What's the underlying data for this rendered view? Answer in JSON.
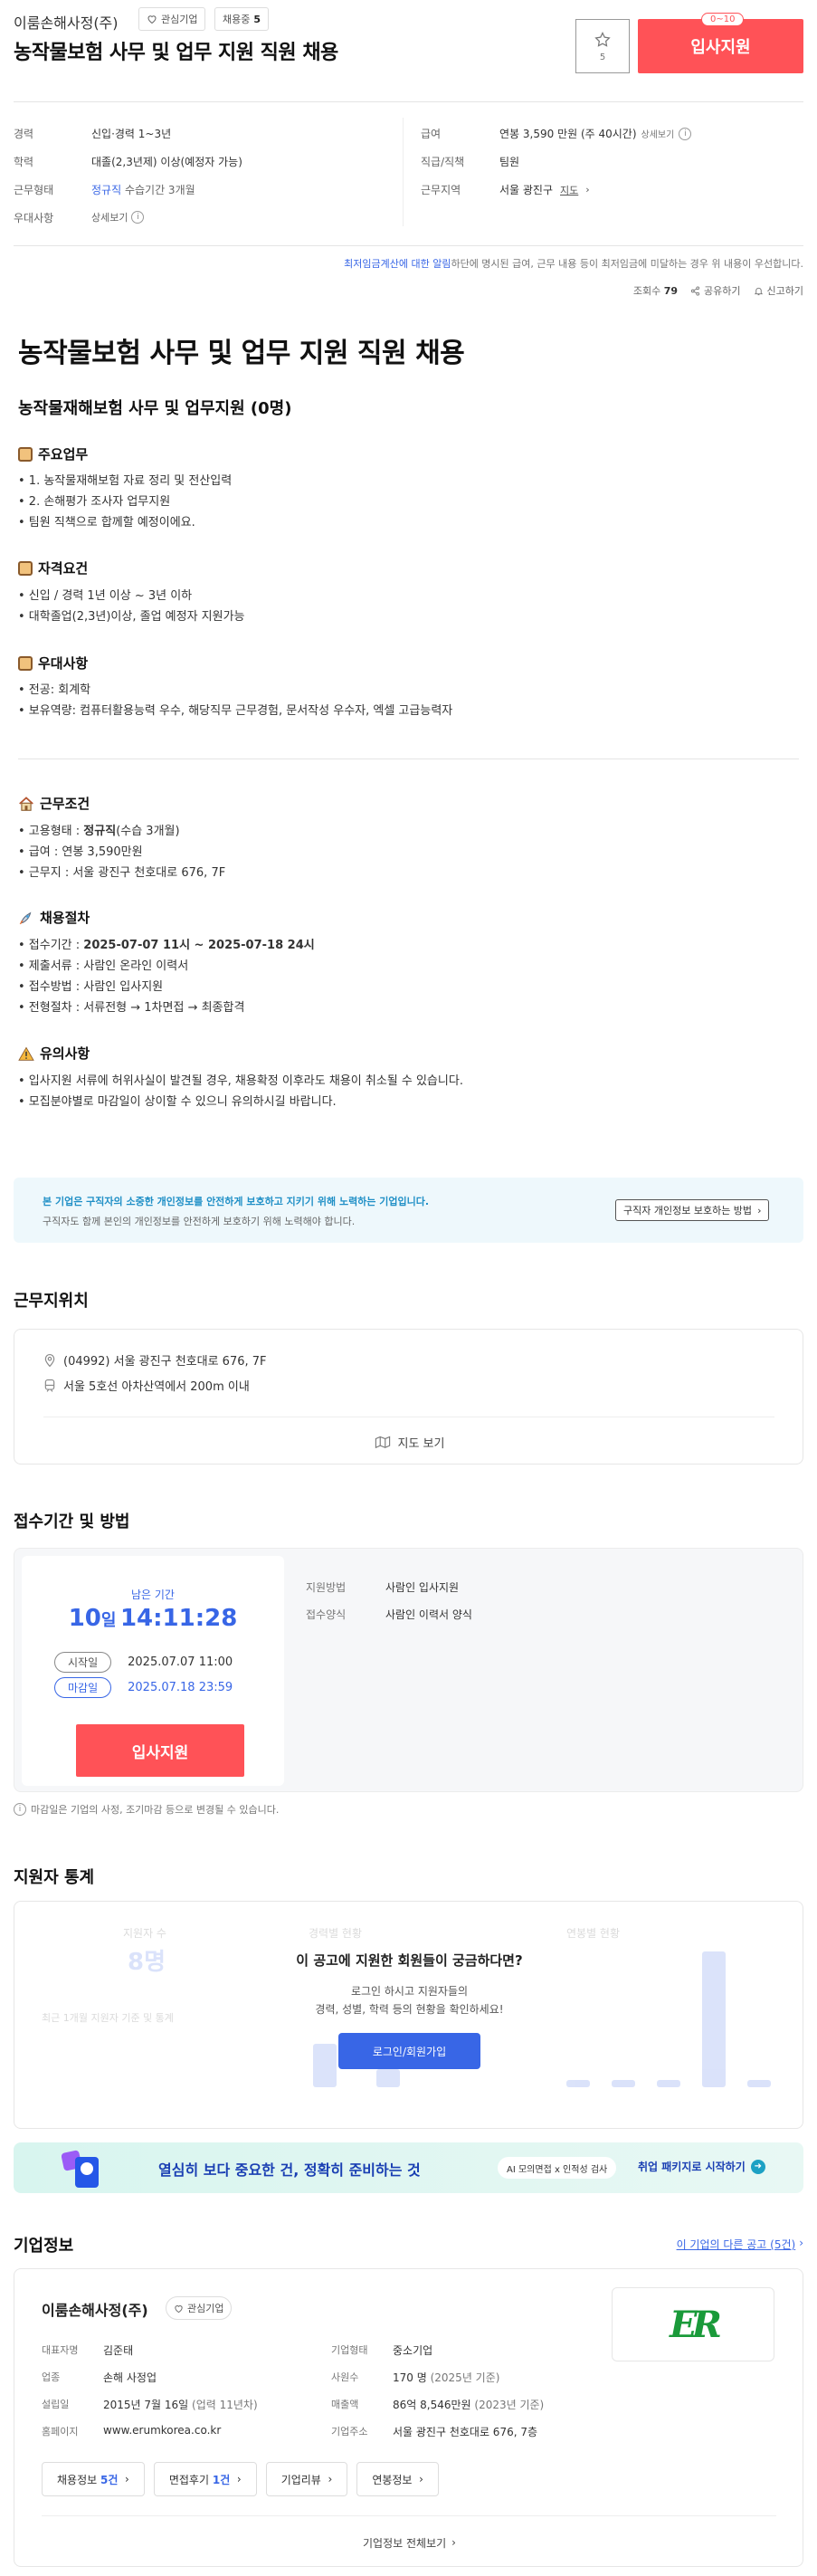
{
  "header": {
    "company": "이룸손해사정(주)",
    "interest_label": "관심기업",
    "hiring_label": "채용중",
    "hiring_count": "5",
    "title": "농작물보험 사무 및 업무 지원 직원 채용",
    "star_count": "5",
    "apply_badge": "0~10",
    "apply_label": "입사지원"
  },
  "summary": {
    "left": [
      {
        "label": "경력",
        "value": "신입·경력 1~3년"
      },
      {
        "label": "학력",
        "value": "대졸(2,3년제) 이상(예정자 가능)"
      },
      {
        "label": "근무형태",
        "value": "정규직",
        "value2": "수습기간 3개월"
      },
      {
        "label": "우대사항",
        "value": "상세보기"
      }
    ],
    "right": [
      {
        "label": "급여",
        "value": "연봉 3,590 만원 (주 40시간)",
        "extra": "상세보기"
      },
      {
        "label": "직급/직책",
        "value": "팀원"
      },
      {
        "label": "근무지역",
        "value": "서울 광진구",
        "extra": "지도"
      }
    ],
    "notice_link": "최저임금계산에 대한 알림",
    "notice_rest": "하단에 명시된 급여, 근무 내용 등이 최저임금에 미달하는 경우 위 내용이 우선합니다.",
    "views_label": "조회수",
    "views": "79",
    "share": "공유하기",
    "report": "신고하기"
  },
  "detail": {
    "title": "농작물보험 사무 및 업무 지원 직원 채용",
    "subtitle": "농작물재해보험 사무 및 업무지원 (0명)",
    "duties_title": "주요업무",
    "duties": [
      "• 1. 농작물재해보험 자료 정리 및 전산입력",
      "• 2. 손해평가 조사자 업무지원",
      "• 팀원 직책으로 합께할 예정이에요."
    ],
    "req_title": "자격요건",
    "reqs": [
      "• 신입 / 경력 1년 이상 ~ 3년 이하",
      "• 대학졸업(2,3년)이상, 졸업 예정자 지원가능"
    ],
    "pref_title": "우대사항",
    "prefs": [
      "• 전공: 회계학",
      "• 보유역량: 컴퓨터활용능력 우수, 해당직무 근무경험, 문서작성 우수자, 엑셀 고급능력자"
    ],
    "cond_title": "근무조건",
    "cond_emp_prefix": "• 고용형태 : ",
    "cond_emp_bold": "정규직",
    "cond_emp_suffix": "(수습 3개월)",
    "cond_salary": "• 급여 : 연봉 3,590만원",
    "cond_place": "• 근무지 : 서울 광진구 천호대로 676, 7F",
    "proc_title": "채용절차",
    "proc_period_prefix": "• 접수기간 : ",
    "proc_period_bold": "2025-07-07 11시 ~ 2025-07-18 24시",
    "proc_docs": "• 제출서류 : 사람인 온라인 이력서",
    "proc_method": "• 접수방법 : 사람인 입사지원",
    "proc_flow": "• 전형절차 : 서류전형 → 1차면접 → 최종합격",
    "note_title": "유의사항",
    "notes": [
      "• 입사지원 서류에 허위사실이 발견될 경우, 채용확정 이후라도 채용이 취소될 수 있습니다.",
      "• 모집분야별로 마감일이 상이할 수 있으니 유의하시길 바랍니다."
    ]
  },
  "privacy": {
    "title": "본 기업은 구직자의 소중한 개인정보를 안전하게 보호하고 지키기 위해 노력하는 기업입니다.",
    "desc": "구직자도 함께 본인의 개인정보를 안전하게 보호하기 위해 노력해야 합니다.",
    "button": "구직자 개인정보 보호하는 방법"
  },
  "location": {
    "title": "근무지위치",
    "address": "(04992) 서울 광진구 천호대로 676, 7F",
    "subway": "서울 5호선 아차산역에서 200m 이내",
    "map_button": "지도 보기"
  },
  "period": {
    "title": "접수기간 및 방법",
    "remain_label": "남은 기간",
    "remain_days": "10",
    "remain_day_unit": "일",
    "remain_time": "14:11:28",
    "start_label": "시작일",
    "start_date": "2025.07.07 11:00",
    "end_label": "마감일",
    "end_date": "2025.07.18 23:59",
    "apply": "입사지원",
    "method_label": "지원방법",
    "method_value": "사람인 입사지원",
    "form_label": "접수양식",
    "form_value": "사람인 이력서 양식",
    "footnote": "마감일은 기업의 사정, 조기마감 등으로 변경될 수 있습니다."
  },
  "stats": {
    "title": "지원자 통계",
    "bg_applicants": "지원자 수",
    "bg_count": "8명",
    "bg_career": "경력별 현황",
    "bg_salary": "연봉별 현황",
    "bg_note": "최근 1개월 지원자 기준 및 통계",
    "overlay_title": "이 공고에 지원한 회원들이 궁금하다면?",
    "overlay_desc1": "로그인 하시고 지원자들의",
    "overlay_desc2": "경력, 성별, 학력 등의 현황을 확인하세요!",
    "overlay_button": "로그인/회원가입",
    "bars": [
      0.05,
      0.05,
      0.05,
      0.88,
      0.05
    ],
    "career_bars": [
      0.28,
      0.12
    ]
  },
  "banner": {
    "text_a": "열심히 보다 중요한 건, ",
    "text_b": "정확히 준비하는 것",
    "chip": "AI 모의면접 x 인적성 검사",
    "cta": "취업 패키지로 시작하기"
  },
  "company": {
    "section_title": "기업정보",
    "other_jobs": "이 기업의 다른 공고 (5건)",
    "name": "이룸손해사정(주)",
    "interest": "관심기업",
    "rows_left": [
      {
        "label": "대표자명",
        "value": "김준태"
      },
      {
        "label": "업종",
        "value": "손해 사정업"
      },
      {
        "label": "설립일",
        "value": "2015년 7월 16일",
        "sub": "(업력 11년차)"
      },
      {
        "label": "홈페이지",
        "value": "www.erumkorea.co.kr"
      }
    ],
    "rows_right": [
      {
        "label": "기업형태",
        "value": "중소기업"
      },
      {
        "label": "사원수",
        "value": "170 명",
        "sub": "(2025년 기준)"
      },
      {
        "label": "매출액",
        "value": "86억 8,546만원",
        "sub": "(2023년 기준)"
      },
      {
        "label": "기업주소",
        "value": "서울 광진구 천호대로 676, 7층"
      }
    ],
    "buttons": [
      {
        "label": "채용정보",
        "count": "5건"
      },
      {
        "label": "면접후기",
        "count": "1건"
      },
      {
        "label": "기업리뷰",
        "count": ""
      },
      {
        "label": "연봉정보",
        "count": ""
      }
    ],
    "more": "기업정보 전체보기",
    "logo_text": "ER",
    "logo_color": "#1a9a3a"
  }
}
